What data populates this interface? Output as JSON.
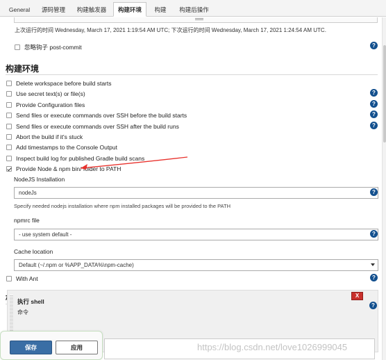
{
  "tabs": [
    {
      "label": "General"
    },
    {
      "label": "源码管理"
    },
    {
      "label": "构建触发器"
    },
    {
      "label": "构建环境"
    },
    {
      "label": "构建"
    },
    {
      "label": "构建后操作"
    }
  ],
  "trigger": {
    "schedule_note": "上次运行的时间 Wednesday, March 17, 2021 1:19:54 AM UTC; 下次运行的时间 Wednesday, March 17, 2021 1:24:54 AM UTC.",
    "ignore_hooks_label": "忽略钩子 post-commit"
  },
  "build_env": {
    "title": "构建环境",
    "options": [
      {
        "label": "Delete workspace before build starts",
        "checked": false
      },
      {
        "label": "Use secret text(s) or file(s)",
        "checked": false
      },
      {
        "label": "Provide Configuration files",
        "checked": false
      },
      {
        "label": "Send files or execute commands over SSH before the build starts",
        "checked": false
      },
      {
        "label": "Send files or execute commands over SSH after the build runs",
        "checked": false
      },
      {
        "label": "Abort the build if it's stuck",
        "checked": false
      },
      {
        "label": "Add timestamps to the Console Output",
        "checked": false
      },
      {
        "label": "Inspect build log for published Gradle build scans",
        "checked": false
      },
      {
        "label": "Provide Node & npm bin/ folder to PATH",
        "checked": true
      }
    ],
    "nodejs": {
      "label": "NodeJS Installation",
      "value": "nodeJs",
      "description": "Specify needed nodejs installation where npm installed packages will be provided to the PATH"
    },
    "npmrc": {
      "label": "npmrc file",
      "value": "- use system default -"
    },
    "cache": {
      "label": "Cache location",
      "value": "Default (~/.npm or %APP_DATA%\\npm-cache)"
    },
    "with_ant_label": "With Ant"
  },
  "build": {
    "title": "构建",
    "step_title": "执行 shell",
    "command_label": "命令",
    "delete_label": "X"
  },
  "actions": {
    "save_label": "保存",
    "apply_label": "应用"
  },
  "watermark": "https://blog.csdn.net/love1026999045",
  "colors": {
    "help_icon": "#13508e",
    "save_button": "#3a6ea5",
    "delete_button": "#c9302c",
    "annotation_arrow": "#e8312c"
  }
}
